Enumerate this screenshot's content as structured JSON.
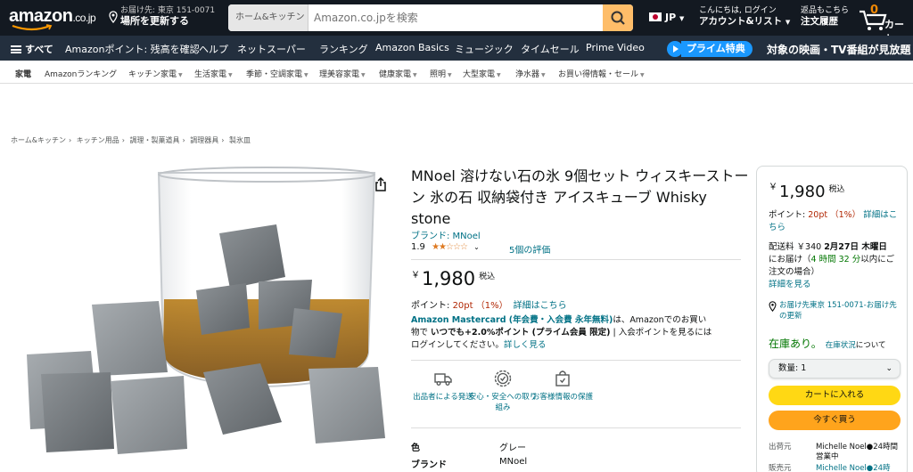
{
  "header": {
    "logo": "amazon",
    "logo_suffix": ".co.jp",
    "deliver_line1": "お届け先: 東京 151-0071",
    "deliver_line2": "場所を更新する",
    "search_category": "ホーム&キッチン",
    "search_placeholder": "Amazon.co.jpを検索",
    "language": "JP",
    "account_line1": "こんにちは, ログイン",
    "account_line2": "アカウント&リスト",
    "orders_line1": "返品もこちら",
    "orders_line2": "注文履歴",
    "cart_count": "0",
    "cart_label": "カート"
  },
  "main_nav": {
    "all": "すべて",
    "items": [
      "Amazonポイント: 残高を確認",
      "ヘルプ",
      "ネットスーパー",
      "ランキング",
      "Amazon Basics",
      "ミュージック",
      "タイムセール",
      "Prime Video"
    ],
    "prime_badge": "プライム特典",
    "prime_promo": "対象の映画・TV番組が見放題"
  },
  "category_nav": {
    "items": [
      "家電",
      "Amazonランキング",
      "キッチン家電",
      "生活家電",
      "季節・空調家電",
      "理美容家電",
      "健康家電",
      "照明",
      "大型家電",
      "浄水器",
      "お買い得情報・セール"
    ]
  },
  "breadcrumb": [
    "ホーム&キッチン",
    "キッチン用品",
    "調理・製菓道具",
    "調理器具",
    "製氷皿"
  ],
  "product": {
    "title": "MNoel 溶けない石の氷 9個セット ウィスキーストーン 氷の石 収納袋付き アイスキューブ Whisky stone",
    "brand": "ブランド: MNoel",
    "rating_value": "1.9",
    "rating_stars": 1.9,
    "rating_count": "5個の評価",
    "price_symbol": "￥",
    "price": "1,980",
    "tax_label": "税込",
    "points_label": "ポイント:",
    "points_value": "20pt （1%）",
    "points_link": "詳細はこちら",
    "card_promo": {
      "title": "Amazon Mastercard (年会費・入会費 永年無料)",
      "text1": "は、Amazonでのお買い物で",
      "bold": "いつでも+2.0%ポイント (プライム会員 限定)",
      "text2": "| 入会ポイントを見るにはログインしてください。",
      "link": "詳しく見る"
    },
    "features": [
      "出品者による発送",
      "安心・安全への取り組み",
      "お客様情報の保護"
    ],
    "specs": [
      {
        "key": "色",
        "value": "グレー"
      },
      {
        "key": "ブランド",
        "value": "MNoel"
      }
    ]
  },
  "buybox": {
    "price_symbol": "￥",
    "price": "1,980",
    "tax_label": "税込",
    "points_label": "ポイント:",
    "points_value": "20pt （1%）",
    "points_link": "詳細はこちら",
    "shipping_label": "配送料 ￥340",
    "delivery_date": "2月27日 木曜日",
    "delivery_text1": "にお届け（",
    "delivery_time": "4 時間 32 分",
    "delivery_text2": "以内にご注文の場合）",
    "details_link": "詳細を見る",
    "location": "お届け先東京 151-0071‐お届け先の更新",
    "stock": "在庫あり。",
    "stock_link": "在庫状況",
    "stock_suffix": "について",
    "quantity": "数量: 1",
    "add_to_cart": "カートに入れる",
    "buy_now": "今すぐ買う",
    "sellers": [
      {
        "key": "出荷元",
        "value": "Michelle Noel●24時間営業中"
      },
      {
        "key": "販売元",
        "value": "Michelle Noel●24時"
      }
    ]
  },
  "colors": {
    "nav_dark": "#131921",
    "nav_secondary": "#232f3e",
    "search_button": "#febd69",
    "link": "#007185",
    "price_red": "#b12704",
    "in_stock": "#007600",
    "cart_button": "#ffd814",
    "buy_button": "#ffa41c",
    "prime_blue": "#1a98ff"
  }
}
